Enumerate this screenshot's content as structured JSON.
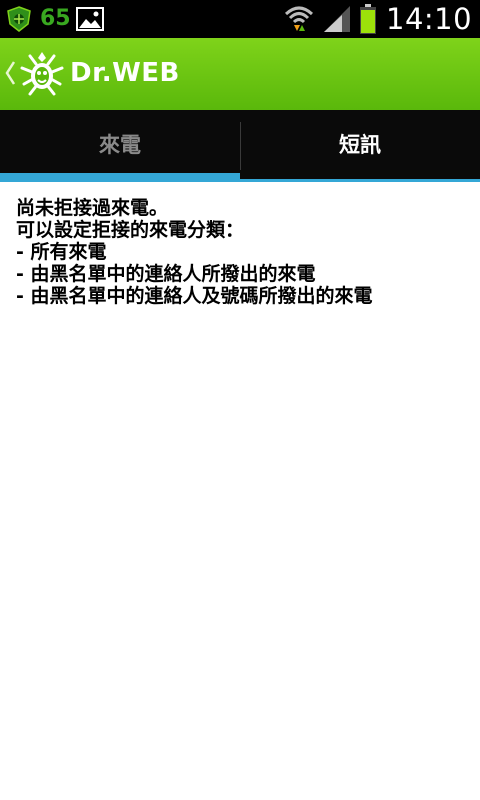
{
  "status_bar": {
    "notification_count": "65",
    "time": "14:10",
    "icons": [
      "drweb-shield-icon",
      "image-icon",
      "wifi-icon",
      "signal-icon",
      "battery-icon"
    ],
    "colors": {
      "count_green": "#39a820",
      "battery_green": "#9ce10a"
    }
  },
  "action_bar": {
    "title": "Dr.WEB",
    "icons": [
      "back-chevron-icon",
      "drweb-spider-logo-icon"
    ],
    "colors": {
      "gradient_top": "#7fd31a",
      "gradient_bottom": "#5ab80b"
    }
  },
  "tabs": {
    "items": [
      {
        "label": "來電",
        "selected": true
      },
      {
        "label": "短訊",
        "selected": false
      }
    ],
    "colors": {
      "indicator": "#34a7d6",
      "background": "#0a0a0a"
    }
  },
  "content": {
    "lines": [
      "尚未拒接過來電。",
      "可以設定拒接的來電分類：",
      "-  所有來電",
      "-  由黑名單中的連絡人所撥出的來電",
      "-  由黑名單中的連絡人及號碼所撥出的來電"
    ]
  }
}
